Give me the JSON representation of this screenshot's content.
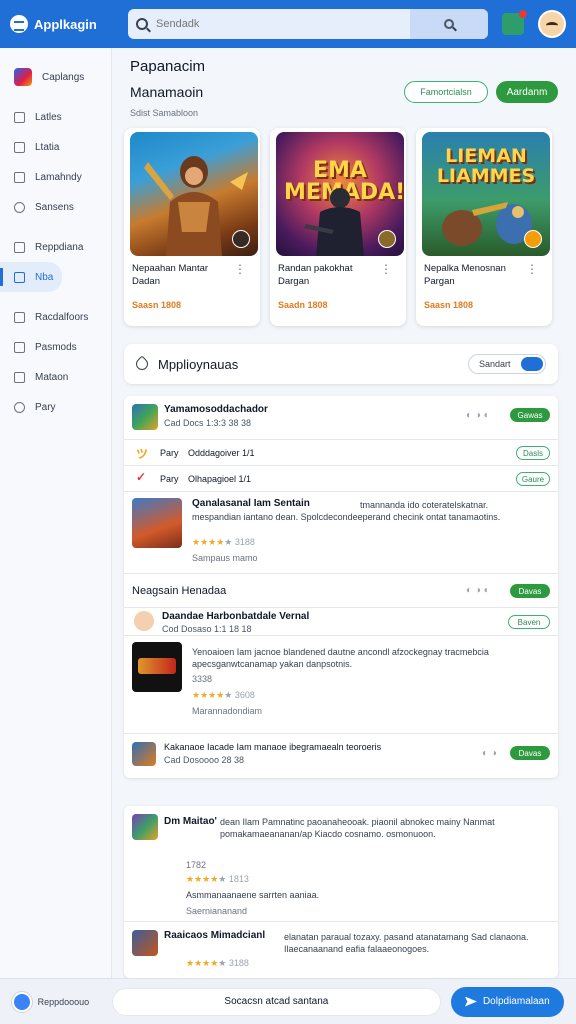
{
  "app": {
    "name": "Applkagin"
  },
  "search": {
    "placeholder": "Sendadk"
  },
  "sidebar": {
    "items": [
      {
        "label": "Caplangs",
        "icon": "app-icon"
      },
      {
        "label": "Latles",
        "icon": "list-icon"
      },
      {
        "label": "Ltatia",
        "icon": "folder-icon"
      },
      {
        "label": "Lamahndy",
        "icon": "grid-icon"
      },
      {
        "label": "Sansens",
        "icon": "search-icon"
      },
      {
        "label": "Reppdiana",
        "icon": "tag-icon"
      },
      {
        "label": "Nba",
        "icon": "box-icon",
        "active": true
      },
      {
        "label": "Racdalfoors",
        "icon": "calendar-icon"
      },
      {
        "label": "Pasmods",
        "icon": "chart-icon"
      },
      {
        "label": "Mataon",
        "icon": "mail-icon"
      },
      {
        "label": "Pary",
        "icon": "cloud-icon"
      }
    ]
  },
  "header": {
    "title": "Papanacim",
    "subtitle": "Manamaoin",
    "caption": "Sdist Samabloon",
    "outline_button": "Famortcialsn",
    "solid_button": "Aardanm"
  },
  "cards": [
    {
      "title": "Nepaahan Mantar Dadan",
      "price": "Saasn 1808",
      "image_text": ""
    },
    {
      "title": "Randan pakokhat Dargan",
      "price": "Saadn 1808",
      "image_text": "EMA MEMADA!"
    },
    {
      "title": "Nepalka Menosnan Pargan",
      "price": "Saasn 1808",
      "image_text": "LIEMAN LIAMMES"
    }
  ],
  "section": {
    "title": "Mpplioynauas",
    "toggle_label": "Sandart"
  },
  "list": {
    "row1": {
      "title": "Yamamosoddachador",
      "sub": "Cad Docs 1:3:3 38 38",
      "pill": "Gawas"
    },
    "row2": {
      "label": "Pary",
      "sub": "Odddagoiver 1/1",
      "pill": "Dasls"
    },
    "row3": {
      "label": "Pary",
      "sub": "Olhapagioel 1/1",
      "pill": "Gaure"
    },
    "row4": {
      "title": "Qanalasanal Iam Sentain",
      "desc_right": "tmannanda ido coteratelskatnar.",
      "desc": "mespandian iantano dean. Spolcdecondeeperand checink ontat tanamaotins.",
      "rating_text": "3188",
      "note": "Sampaus mamo"
    },
    "subheader": {
      "title": "Neagsain Henadaa",
      "pill": "Davas"
    },
    "row5": {
      "title": "Daandae Harbonbatdale Vernal",
      "sub": "Cod Dosaso 1:1 18 18",
      "pill": "Baven"
    },
    "row6": {
      "title": "Yenoaioen Iam",
      "desc": "Yenoaioen Iam jacnoe blandened dautne ancondl afzockegnay tracmebcia apecsganwtcanamap yakan danpsotnis.",
      "rating_text": "3608",
      "rating2": "3338",
      "note": "Marannadondiam"
    },
    "row7": {
      "title": "Kakanaoe",
      "desc": "Kakanaoe Iacade Iam manaoe ibegramaealn teoroeris",
      "sub": "Cad Dosoooo 28 38",
      "pill": "Davas"
    }
  },
  "list2": {
    "row1": {
      "title": "Dm Maitao'",
      "desc": "dean Ilam Pamnatinc paoanaheooak. piaonil abnokec mainy Nanmat pomakamaeananan/ap Kiacdo cosnamo. osmonuoon.",
      "rating_text": "1813",
      "rating2": "1782",
      "note": "Asmmanaanaene sarrten aaniaa.",
      "note2": "Saerniananand"
    },
    "row2": {
      "title": "Raaicaos Mimadcianl",
      "desc": "elanatan paraual tozaxy. pasand atanatamang Sad clanaona. Ilaecanaanand eafia falaaeonogoes.",
      "rating_text": "3188"
    }
  },
  "bottom": {
    "user_label": "Reppdooouo",
    "input_text": "Socacsn atcad santana",
    "button_label": "Dolpdiamalaan"
  },
  "colors": {
    "primary": "#1f6fd6",
    "accent_green": "#2e9a3f",
    "price": "#e07b1f"
  }
}
